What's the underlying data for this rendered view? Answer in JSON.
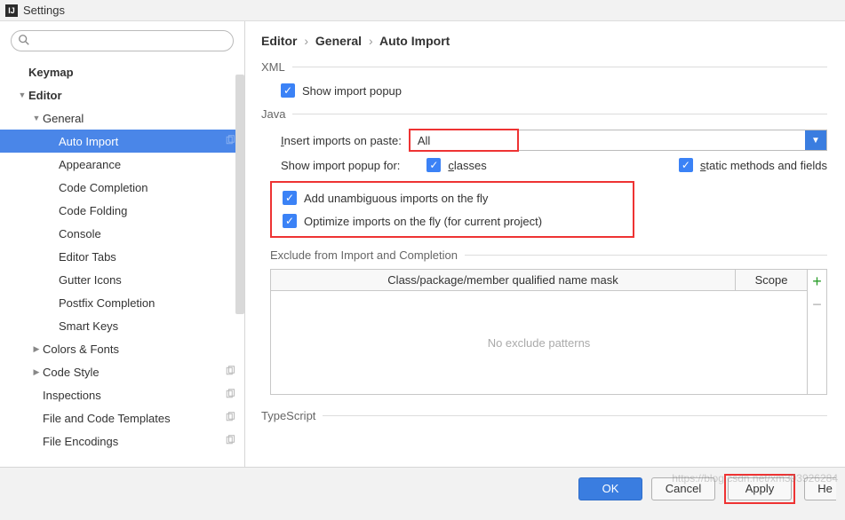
{
  "title": "Settings",
  "sidebar": {
    "search_placeholder": "",
    "items": [
      {
        "label": "Keymap",
        "indent": 0,
        "bold": true,
        "arrow": "",
        "badge": false,
        "selected": false
      },
      {
        "label": "Editor",
        "indent": 0,
        "bold": true,
        "arrow": "down",
        "badge": false,
        "selected": false
      },
      {
        "label": "General",
        "indent": 1,
        "bold": false,
        "arrow": "down",
        "badge": false,
        "selected": false
      },
      {
        "label": "Auto Import",
        "indent": 2,
        "bold": false,
        "arrow": "",
        "badge": true,
        "selected": true
      },
      {
        "label": "Appearance",
        "indent": 2,
        "bold": false,
        "arrow": "",
        "badge": false,
        "selected": false
      },
      {
        "label": "Code Completion",
        "indent": 2,
        "bold": false,
        "arrow": "",
        "badge": false,
        "selected": false
      },
      {
        "label": "Code Folding",
        "indent": 2,
        "bold": false,
        "arrow": "",
        "badge": false,
        "selected": false
      },
      {
        "label": "Console",
        "indent": 2,
        "bold": false,
        "arrow": "",
        "badge": false,
        "selected": false
      },
      {
        "label": "Editor Tabs",
        "indent": 2,
        "bold": false,
        "arrow": "",
        "badge": false,
        "selected": false
      },
      {
        "label": "Gutter Icons",
        "indent": 2,
        "bold": false,
        "arrow": "",
        "badge": false,
        "selected": false
      },
      {
        "label": "Postfix Completion",
        "indent": 2,
        "bold": false,
        "arrow": "",
        "badge": false,
        "selected": false
      },
      {
        "label": "Smart Keys",
        "indent": 2,
        "bold": false,
        "arrow": "",
        "badge": false,
        "selected": false
      },
      {
        "label": "Colors & Fonts",
        "indent": 1,
        "bold": false,
        "arrow": "right",
        "badge": false,
        "selected": false
      },
      {
        "label": "Code Style",
        "indent": 1,
        "bold": false,
        "arrow": "right",
        "badge": true,
        "selected": false
      },
      {
        "label": "Inspections",
        "indent": 1,
        "bold": false,
        "arrow": "",
        "badge": true,
        "selected": false
      },
      {
        "label": "File and Code Templates",
        "indent": 1,
        "bold": false,
        "arrow": "",
        "badge": true,
        "selected": false
      },
      {
        "label": "File Encodings",
        "indent": 1,
        "bold": false,
        "arrow": "",
        "badge": true,
        "selected": false
      }
    ]
  },
  "breadcrumb": {
    "a": "Editor",
    "b": "General",
    "c": "Auto Import"
  },
  "xml": {
    "title": "XML",
    "show_popup_label": "Show import popup",
    "show_popup_checked": true
  },
  "java": {
    "title": "Java",
    "insert_label": "Insert imports on paste:",
    "insert_value": "All",
    "show_popup_for_label": "Show import popup for:",
    "classes_label": "classes",
    "classes_checked": true,
    "static_label": "static methods and fields",
    "static_checked": true,
    "add_unambiguous_label": "Add unambiguous imports on the fly",
    "add_unambiguous_checked": true,
    "optimize_label": "Optimize imports on the fly (for current project)",
    "optimize_checked": true,
    "exclude_title": "Exclude from Import and Completion",
    "exclude_header_mask": "Class/package/member qualified name mask",
    "exclude_header_scope": "Scope",
    "exclude_empty": "No exclude patterns"
  },
  "ts": {
    "title": "TypeScript"
  },
  "footer": {
    "ok": "OK",
    "cancel": "Cancel",
    "apply": "Apply",
    "help": "He"
  },
  "watermark": "https://blog.csdn.net/xm393926284"
}
